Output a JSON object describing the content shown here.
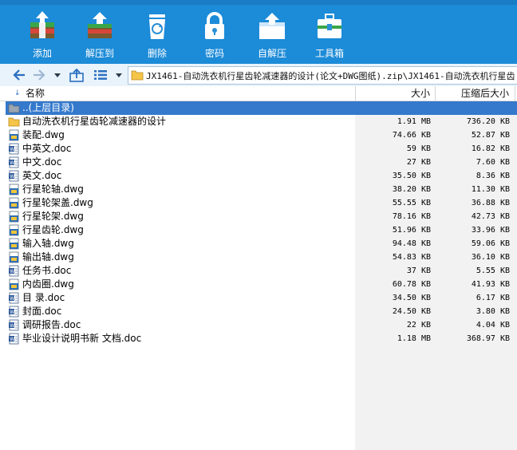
{
  "toolbar": {
    "buttons": [
      {
        "label": "添加",
        "icon": "add-archive-icon"
      },
      {
        "label": "解压到",
        "icon": "extract-to-icon"
      },
      {
        "label": "删除",
        "icon": "recycle-bin-icon"
      },
      {
        "label": "密码",
        "icon": "lock-icon"
      },
      {
        "label": "自解压",
        "icon": "self-extract-icon"
      },
      {
        "label": "工具箱",
        "icon": "toolbox-icon"
      }
    ]
  },
  "address": {
    "path": "JX1461-自动洗衣机行星齿轮减速器的设计(论文+DWG图纸).zip\\JX1461-自动洗衣机行星齿"
  },
  "columns": {
    "name": "名称",
    "size": "大小",
    "compressed": "压缩后大小"
  },
  "files": [
    {
      "name": "..(上层目录)",
      "size": "",
      "compressed": "",
      "type": "parent"
    },
    {
      "name": "自动洗衣机行星齿轮减速器的设计",
      "size": "1.91 MB",
      "compressed": "736.20 KB",
      "type": "folder"
    },
    {
      "name": "装配.dwg",
      "size": "74.66 KB",
      "compressed": "52.87 KB",
      "type": "dwg"
    },
    {
      "name": "中英文.doc",
      "size": "59 KB",
      "compressed": "16.82 KB",
      "type": "doc"
    },
    {
      "name": "中文.doc",
      "size": "27 KB",
      "compressed": "7.60 KB",
      "type": "doc"
    },
    {
      "name": "英文.doc",
      "size": "35.50 KB",
      "compressed": "8.36 KB",
      "type": "doc"
    },
    {
      "name": "行星轮轴.dwg",
      "size": "38.20 KB",
      "compressed": "11.30 KB",
      "type": "dwg"
    },
    {
      "name": "行星轮架盖.dwg",
      "size": "55.55 KB",
      "compressed": "36.88 KB",
      "type": "dwg"
    },
    {
      "name": "行星轮架.dwg",
      "size": "78.16 KB",
      "compressed": "42.73 KB",
      "type": "dwg"
    },
    {
      "name": "行星齿轮.dwg",
      "size": "51.96 KB",
      "compressed": "33.96 KB",
      "type": "dwg"
    },
    {
      "name": "输入轴.dwg",
      "size": "94.48 KB",
      "compressed": "59.06 KB",
      "type": "dwg"
    },
    {
      "name": "输出轴.dwg",
      "size": "54.83 KB",
      "compressed": "36.10 KB",
      "type": "dwg"
    },
    {
      "name": "任务书.doc",
      "size": "37 KB",
      "compressed": "5.55 KB",
      "type": "doc"
    },
    {
      "name": "内齿圈.dwg",
      "size": "60.78 KB",
      "compressed": "41.93 KB",
      "type": "dwg"
    },
    {
      "name": "目    录.doc",
      "size": "34.50 KB",
      "compressed": "6.17 KB",
      "type": "doc"
    },
    {
      "name": "封面.doc",
      "size": "24.50 KB",
      "compressed": "3.80 KB",
      "type": "doc"
    },
    {
      "name": "调研报告.doc",
      "size": "22 KB",
      "compressed": "4.04 KB",
      "type": "doc"
    },
    {
      "name": "毕业设计说明书新 文档.doc",
      "size": "1.18 MB",
      "compressed": "368.97 KB",
      "type": "doc"
    }
  ],
  "colors": {
    "toolbar": "#1c8bd8",
    "selection": "#3479cc",
    "folder": "#f5c54a"
  }
}
